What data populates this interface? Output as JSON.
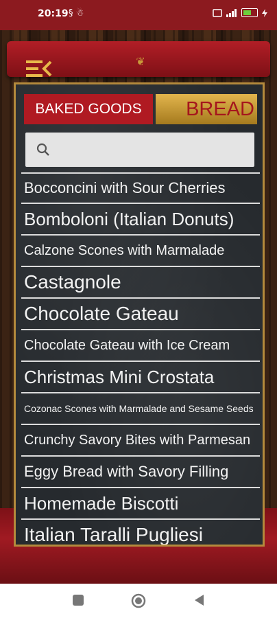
{
  "status_bar": {
    "time": "20:19",
    "left_icons": "§ ☃",
    "battery_level": 0.6
  },
  "colors": {
    "accent_red": "#b01a22",
    "gold": "#c89a3a",
    "board": "#262a2e"
  },
  "header": {
    "menu_icon": "menu-collapse-icon",
    "ornament_icon": "ornament-icon"
  },
  "tabs": [
    {
      "label": "BAKED GOODS",
      "selected": false
    },
    {
      "label": "BREAD",
      "selected": true
    }
  ],
  "search": {
    "placeholder": "",
    "value": "",
    "icon": "search-icon"
  },
  "recipes": [
    "Bocconcini with Sour Cherries",
    "Bomboloni (Italian Donuts)",
    "Calzone Scones with Marmalade",
    "Castagnole",
    "Chocolate Gateau",
    "Chocolate Gateau with Ice Cream",
    "Christmas Mini Crostata",
    "Cozonac Scones with Marmalade and Sesame Seeds",
    "Crunchy Savory Bites with Parmesan",
    "Eggy Bread with Savory Filling",
    "Homemade Biscotti",
    "Italian Taralli Pugliesi"
  ],
  "navbar": {
    "recents_icon": "recents-square-icon",
    "home_icon": "home-circle-icon",
    "back_icon": "back-triangle-icon"
  }
}
